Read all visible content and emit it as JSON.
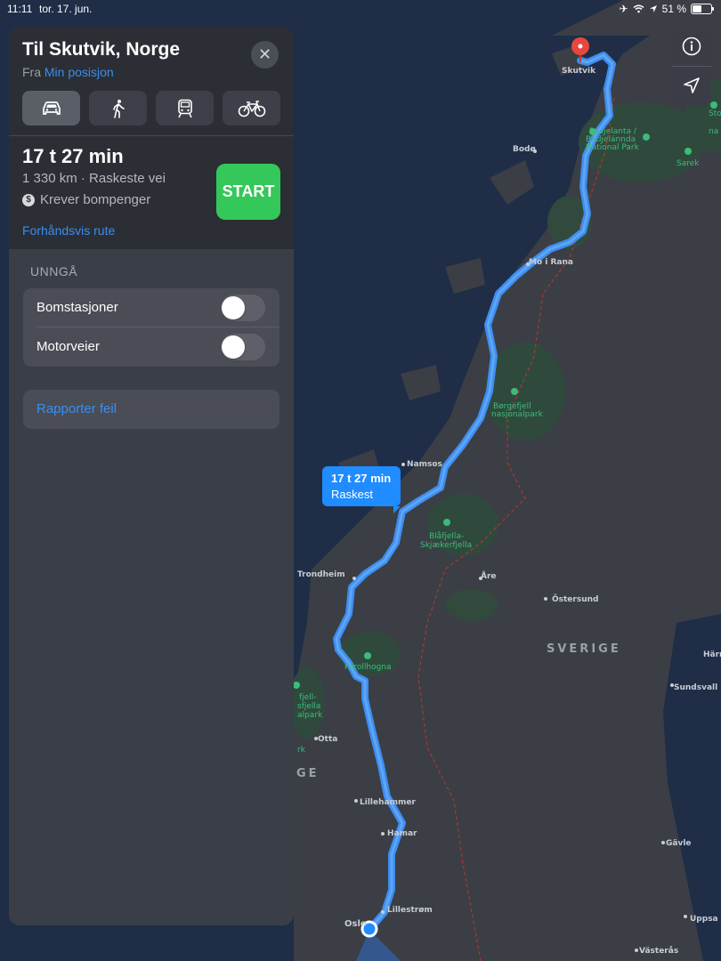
{
  "status": {
    "time": "11:11",
    "date": "tor. 17. jun.",
    "battery_percent": "51 %",
    "battery_level": 0.51
  },
  "directions": {
    "title": "Til Skutvik, Norge",
    "from_prefix": "Fra",
    "from_link": "Min posisjon",
    "close_icon": "close-icon",
    "modes": [
      {
        "name": "car-icon",
        "active": true
      },
      {
        "name": "walk-icon",
        "active": false
      },
      {
        "name": "transit-icon",
        "active": false
      },
      {
        "name": "bike-icon",
        "active": false
      }
    ],
    "eta": "17 t 27 min",
    "distance": "1 330 km · Raskeste vei",
    "toll": "Krever bompenger",
    "start_label": "START",
    "preview_label": "Forhåndsvis rute"
  },
  "avoid": {
    "heading": "UNNGÅ",
    "options": [
      {
        "label": "Bomstasjoner",
        "enabled": false
      },
      {
        "label": "Motorveier",
        "enabled": false
      }
    ]
  },
  "report_label": "Rapporter feil",
  "route_callout": {
    "time": "17 t 27 min",
    "label": "Raskest"
  },
  "map": {
    "colors": {
      "sea": "#1f2d47",
      "land": "#3b3e45",
      "forest": "#2f4a3d",
      "route": "#3d8ef0",
      "border": "#c0392b",
      "pin": "#e8473c"
    },
    "places": {
      "skutvik": "Skutvik",
      "bodo": "Bodø",
      "mo_i_rana": "Mo i Rana",
      "namsos": "Namsos",
      "trondheim": "Trondheim",
      "are": "Åre",
      "ostersund": "Östersund",
      "otta": "Otta",
      "lillehammer": "Lillehammer",
      "hamar": "Hamar",
      "lillestrom": "Lillestrøm",
      "oslo": "Oslo",
      "sundsvall": "Sundsvall",
      "gavle": "Gävle",
      "uppsala": "Uppsa",
      "vasteras": "Västerås",
      "harnosand": "Härn"
    },
    "parks": {
      "padjelanta": "Padjelanta /",
      "padjelanta2": "Badjelánnda",
      "padjelanta3": "National Park",
      "sarek": "Sarek",
      "sto": "Sto",
      "sto2": "na",
      "borgefjell": "Børgefjell",
      "borgefjell2": "nasjonalpark",
      "blafjella": "Blåfjella-",
      "blafjella2": "Skjækerfjella",
      "forollhogna": "Forollhogna",
      "rondane1": "fjell-",
      "rondane2": "sfjella",
      "rondane3": "alpark",
      "rondane4": "rk"
    },
    "countries": {
      "sverige": "SVERIGE",
      "norge": "GE"
    }
  }
}
